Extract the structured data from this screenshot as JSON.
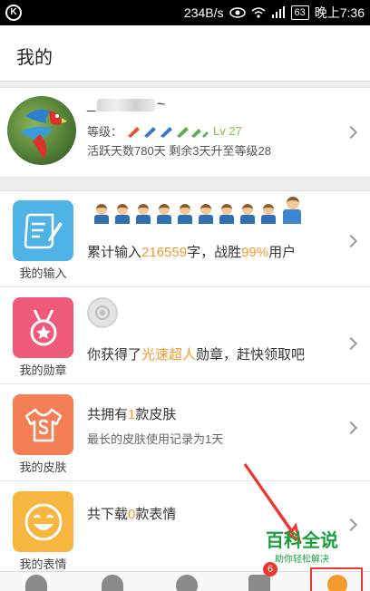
{
  "status_bar": {
    "left_icon_glyph": "K",
    "speed": "234B/s",
    "battery": "63",
    "time": "晚上7:36"
  },
  "header": {
    "title": "我的"
  },
  "profile": {
    "name_prefix": "_",
    "name_suffix": "~",
    "level_label": "等级：",
    "level_value": "Lv 27",
    "active_text": "活跃天数780天 剩余3天升至等级28"
  },
  "rows": [
    {
      "caption": "我的输入",
      "line1_parts": [
        "累计输入",
        "216559",
        "字，战胜",
        "99%",
        "用户"
      ],
      "color": "#4fb3e6"
    },
    {
      "caption": "我的勋章",
      "line1_parts": [
        "你获得了",
        "光速超人",
        "勋章，赶快领取吧"
      ],
      "color": "#ef5a7a"
    },
    {
      "caption": "我的皮肤",
      "line1_parts": [
        "共拥有",
        "1",
        "款皮肤"
      ],
      "line2": "最长的皮肤使用记录为1天",
      "color": "#f47f55"
    },
    {
      "caption": "我的表情",
      "line1_parts": [
        "共下载",
        "0",
        "款表情"
      ],
      "color": "#f6b640"
    }
  ],
  "tabbar": {
    "badge": "6"
  },
  "watermark": {
    "big": "百科全说",
    "small": "助你轻松解决"
  },
  "colors": {
    "accent_orange": "#f39a2d",
    "badge_red": "#e8382f",
    "level_green": "#7cc046"
  }
}
